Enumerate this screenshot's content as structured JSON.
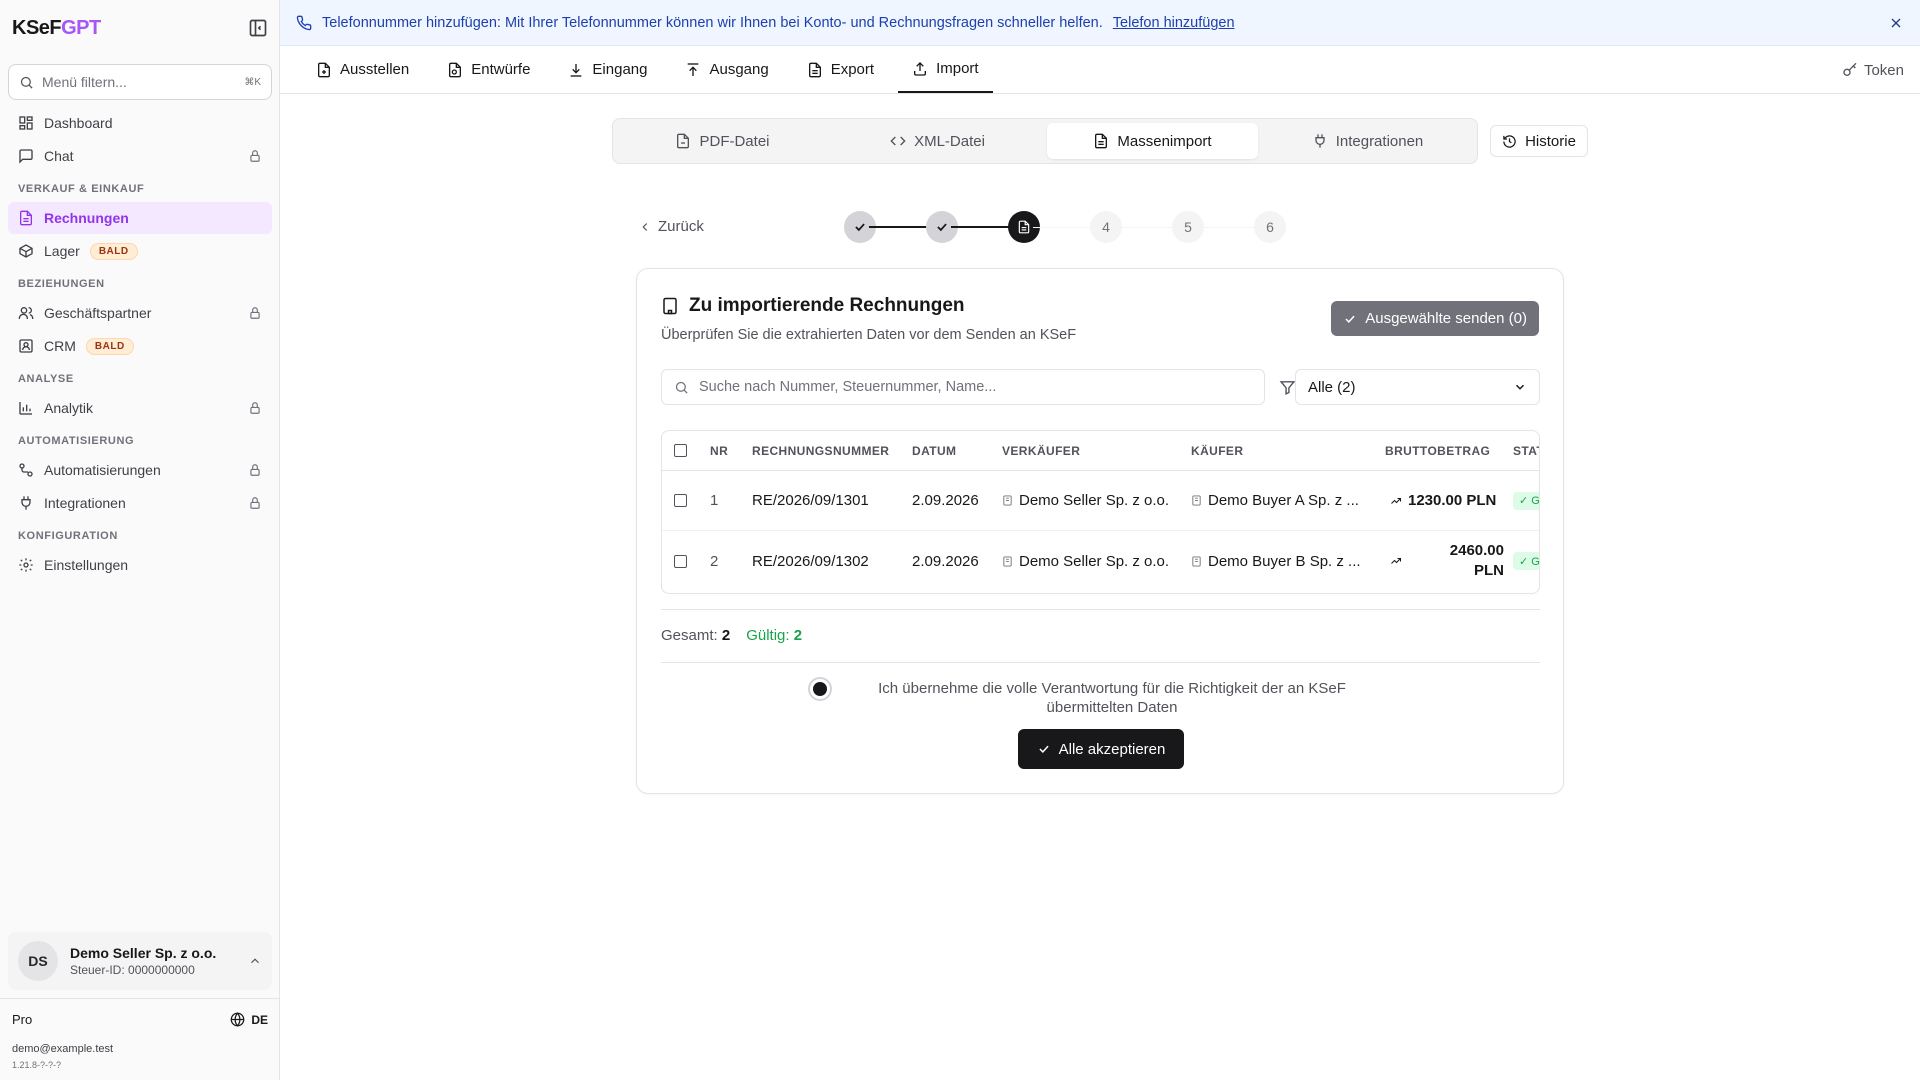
{
  "app": {
    "logo_main": "KSeF",
    "logo_accent": "GPT"
  },
  "sidebar": {
    "filter_placeholder": "Menü filtern...",
    "filter_shortcut": "⌘K",
    "items": [
      {
        "label": "Dashboard"
      },
      {
        "label": "Chat"
      },
      {
        "section": "VERKAUF & EINKAUF"
      },
      {
        "label": "Rechnungen"
      },
      {
        "label": "Lager",
        "badge": "BALD"
      },
      {
        "section": "BEZIEHUNGEN"
      },
      {
        "label": "Geschäftspartner"
      },
      {
        "label": "CRM",
        "badge": "BALD"
      },
      {
        "section": "ANALYSE"
      },
      {
        "label": "Analytik"
      },
      {
        "section": "AUTOMATISIERUNG"
      },
      {
        "label": "Automatisierungen"
      },
      {
        "label": "Integrationen"
      },
      {
        "section": "KONFIGURATION"
      },
      {
        "label": "Einstellungen"
      }
    ],
    "account": {
      "initials": "DS",
      "name": "Demo Seller Sp. z o.o.",
      "tax_id": "Steuer-ID: 0000000000"
    },
    "plan": "Pro",
    "language": "DE",
    "email": "demo@example.test",
    "version": "1.21.8-?-?-?"
  },
  "banner": {
    "text": "Telefonnummer hinzufügen: Mit Ihrer Telefonnummer können wir Ihnen bei Konto- und Rechnungsfragen schneller helfen.",
    "link": "Telefon hinzufügen"
  },
  "topnav": {
    "tabs": [
      "Ausstellen",
      "Entwürfe",
      "Eingang",
      "Ausgang",
      "Export",
      "Import"
    ],
    "active": "Import",
    "token": "Token"
  },
  "subtabs": {
    "tabs": [
      "PDF-Datei",
      "XML-Datei",
      "Massenimport",
      "Integrationen"
    ],
    "active": "Massenimport",
    "history": "Historie"
  },
  "stepper": {
    "back": "Zurück",
    "steps": [
      "",
      "",
      "",
      "4",
      "5",
      "6"
    ],
    "current": 3
  },
  "card": {
    "title": "Zu importierende Rechnungen",
    "subtitle": "Überprüfen Sie die extrahierten Daten vor dem Senden an KSeF",
    "send_button": "Ausgewählte senden (0)",
    "search_placeholder": "Suche nach Nummer, Steuernummer, Name...",
    "filter_value": "Alle (2)",
    "columns": [
      "NR",
      "RECHNUNGSNUMMER",
      "DATUM",
      "VERKÄUFER",
      "KÄUFER",
      "BRUTTOBETRAG",
      "STAT"
    ],
    "rows": [
      {
        "nr": "1",
        "number": "RE/2026/09/1301",
        "date": "2.09.2026",
        "seller": "Demo Seller Sp. z o.o.",
        "buyer": "Demo Buyer A Sp. z ...",
        "amount": "1230.00 PLN",
        "status": "✓ G"
      },
      {
        "nr": "2",
        "number": "RE/2026/09/1302",
        "date": "2.09.2026",
        "seller": "Demo Seller Sp. z o.o.",
        "buyer": "Demo Buyer B Sp. z ...",
        "amount_line1": "2460.00",
        "amount_line2": "PLN",
        "status": "✓ G"
      }
    ],
    "total_label": "Gesamt:",
    "total_value": "2",
    "valid_label": "Gültig:",
    "valid_value": "2",
    "responsibility_text": "Ich übernehme die volle Verantwortung für die Richtigkeit der an KSeF übermittelten Daten",
    "accept_button": "Alle akzeptieren"
  },
  "colors": {
    "accent": "#a855f7",
    "active_bg": "#f3e8ff",
    "banner_bg": "#eff6ff",
    "banner_text": "#1e40af",
    "success": "#16a34a",
    "badge_bg": "#ffedd5"
  }
}
